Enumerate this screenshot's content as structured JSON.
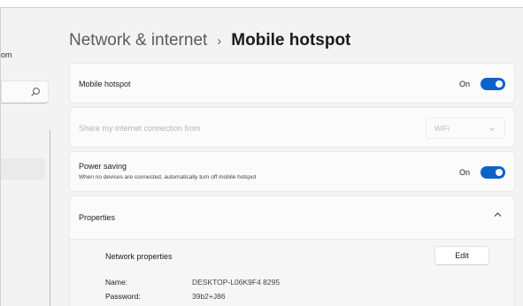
{
  "sidebar": {
    "user_text_fragment": "om",
    "search_icon": "search-icon"
  },
  "breadcrumb": {
    "parent": "Network & internet",
    "separator": "›",
    "current": "Mobile hotspot"
  },
  "mobile_hotspot": {
    "label": "Mobile hotspot",
    "state_label": "On",
    "enabled": true
  },
  "share_connection": {
    "label": "Share my internet connection from",
    "value": "WiFi",
    "disabled": true
  },
  "power_saving": {
    "label": "Power saving",
    "description": "When no devices are connected, automatically turn off mobile hotspot",
    "state_label": "On",
    "enabled": true
  },
  "properties": {
    "label": "Properties",
    "expanded": true,
    "network_properties_label": "Network properties",
    "edit_label": "Edit",
    "name_label": "Name:",
    "name_value": "DESKTOP-L06K9F4 8295",
    "password_label": "Password:",
    "password_value": "39b2+J86"
  },
  "colors": {
    "accent": "#0a63c8",
    "background": "#f3f3f3",
    "card": "#fbfbfb"
  }
}
